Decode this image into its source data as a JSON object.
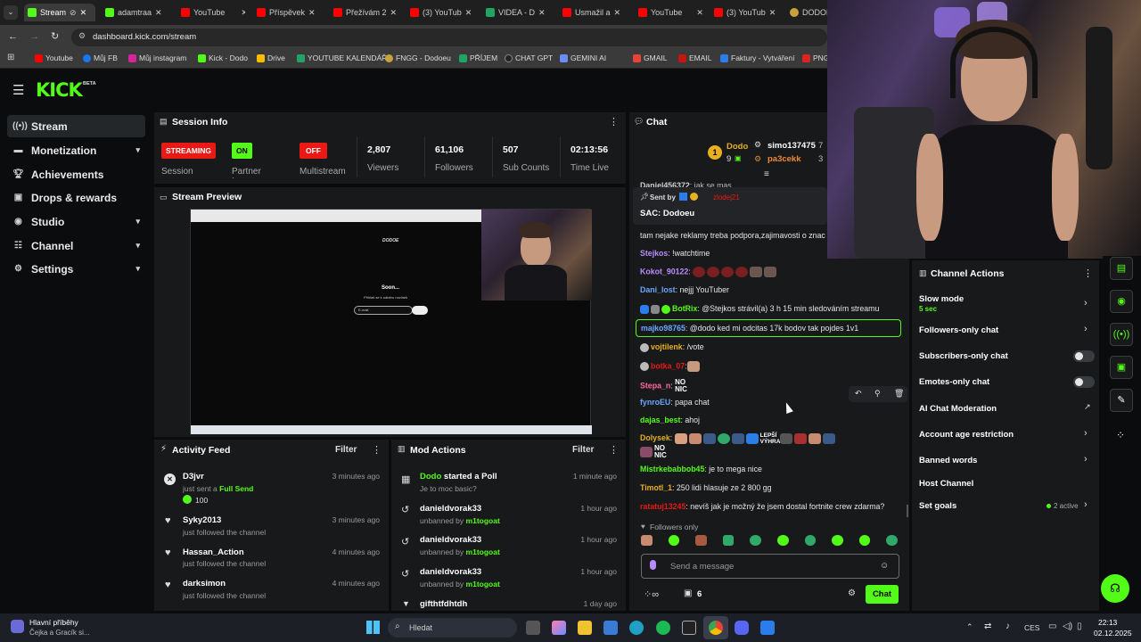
{
  "browser": {
    "tabs": [
      {
        "label": "Stream"
      },
      {
        "label": "adamtraa"
      },
      {
        "label": "YouTube"
      },
      {
        "label": "Příspěvek"
      },
      {
        "label": "Přežívám 2"
      },
      {
        "label": "(3) YouTub"
      },
      {
        "label": "VIDEA - D"
      },
      {
        "label": "Usmažil a"
      },
      {
        "label": "YouTube"
      },
      {
        "label": "(3) YouTub"
      },
      {
        "label": "DODOE"
      }
    ],
    "url": "dashboard.kick.com/stream",
    "bookmarks": [
      "Youtube",
      "Můj FB",
      "Můj instagram",
      "Kick - Dodo",
      "Drive",
      "YOUTUBE KALENDÁŘ",
      "FNGG - Dodoeu",
      "PŘÍJEM",
      "CHAT GPT",
      "GEMINI AI",
      "GMAIL",
      "EMAIL",
      "Faktury - Vytváření",
      "PNG"
    ]
  },
  "kick": {
    "logo": "KICK",
    "logo_sup": "BETA"
  },
  "sidebar": {
    "items": [
      {
        "label": "Stream"
      },
      {
        "label": "Monetization"
      },
      {
        "label": "Achievements"
      },
      {
        "label": "Drops & rewards"
      },
      {
        "label": "Studio"
      },
      {
        "label": "Channel"
      },
      {
        "label": "Settings"
      }
    ]
  },
  "session": {
    "title": "Session Info",
    "streaming_badge": "STREAMING",
    "on_badge": "ON",
    "off_badge": "OFF",
    "session_label": "Session",
    "partner_label": "Partner Income",
    "multistream_label": "Multistream",
    "viewers": "2,807",
    "viewers_label": "Viewers",
    "followers": "61,106",
    "followers_label": "Followers",
    "subs": "507",
    "subs_label": "Sub Counts",
    "time": "02:13:56",
    "time_label": "Time Live"
  },
  "preview": {
    "title": "Stream Preview",
    "site_heading": "Soon...",
    "site_sub": "Přihlaš se k odběru novinek",
    "site_input": "E-mail"
  },
  "activity": {
    "title": "Activity Feed",
    "filter": "Filter",
    "items": [
      {
        "name": "D3jvr",
        "sub": "just sent a",
        "extra": "Full Send",
        "amount": "100",
        "time": "3 minutes ago"
      },
      {
        "name": "Syky2013",
        "sub": "just followed the channel",
        "time": "3 minutes ago"
      },
      {
        "name": "Hassan_Action",
        "sub": "just followed the channel",
        "time": "4 minutes ago"
      },
      {
        "name": "darksimon",
        "sub": "just followed the channel",
        "time": "4 minutes ago"
      }
    ]
  },
  "mod": {
    "title": "Mod Actions",
    "filter": "Filter",
    "items": [
      {
        "name": "Dodo",
        "action": "started a Poll",
        "sub": "Je to moc basic?",
        "time": "1 minute ago"
      },
      {
        "name": "danieldvorak33",
        "sub": "unbanned by",
        "by": "m1togoat",
        "time": "1 hour ago"
      },
      {
        "name": "danieldvorak33",
        "sub": "unbanned by",
        "by": "m1togoat",
        "time": "1 hour ago"
      },
      {
        "name": "danieldvorak33",
        "sub": "unbanned by",
        "by": "m1togoat",
        "time": "1 hour ago"
      },
      {
        "name": "gifthtfdhtdh",
        "time": "1 day ago"
      }
    ]
  },
  "chat": {
    "title": "Chat",
    "leader_name": "Dodo",
    "leader_count": "9",
    "leader_rank": "1",
    "top2": "simo137475",
    "top2_n": "7",
    "top3": "pa3cekk",
    "top3_n": "3",
    "pinned_by": "Sent by",
    "pinned_user": "zlodej21",
    "pinned_text": "SAC: Dodoeu",
    "partial_user": "Daniel456372",
    "partial_text": ": jak se mas",
    "lines": [
      {
        "user": "",
        "text": "tam nejake reklamy treba podpora,zajimavosti o znac"
      },
      {
        "user": "Stejkos",
        "text": ": !watchtime"
      },
      {
        "user": "Kokot_90122",
        "text": ":"
      },
      {
        "user": "Dani_lost",
        "text": ": nejjj YouTuber"
      },
      {
        "user": "BotRix",
        "text": ": @Stejkos strávil(a) 3 h 15 min sledováním streamu"
      },
      {
        "user": "majko98765",
        "text": ": @dodo ked mi odcitas 17k bodov tak pojdes 1v1"
      },
      {
        "user": "vojtilenk",
        "text": ": /vote"
      },
      {
        "user": "botka_07",
        "text": ":"
      },
      {
        "user": "Stepa_n",
        "text": ":"
      },
      {
        "user": "fynroEU",
        "text": ": papa chat"
      },
      {
        "user": "dajas_best",
        "text": ": ahoj"
      },
      {
        "user": "Dolysek",
        "text": ":"
      },
      {
        "user": "Mistrkebabbob45",
        "text": ": je to mega nice"
      },
      {
        "user": "Timotl_1",
        "text": ": 250 lidi hlasuje ze 2 800 gg"
      },
      {
        "user": "ratatuj13245",
        "text": ": nevíš jak je možný že jsem dostal fortnite crew zdarma?"
      }
    ],
    "noic": "NO NIC",
    "lepsi": "LEPŠÍ VÝHRA",
    "followers_only": "Followers only",
    "placeholder": "Send a message",
    "points": "6",
    "send": "Chat"
  },
  "channel_actions": {
    "title": "Channel Actions",
    "slow_mode": "Slow mode",
    "slow_sub": "5 sec",
    "followers_only": "Followers-only chat",
    "subscribers_only": "Subscribers-only chat",
    "emotes_only": "Emotes-only chat",
    "ai_mod": "AI Chat Moderation",
    "account_age": "Account age restriction",
    "banned_words": "Banned words",
    "host": "Host Channel",
    "set_goals": "Set goals",
    "goals_active": "2 active"
  },
  "taskbar": {
    "news_title": "Hlavní příběhy",
    "news_sub": "Čejka a Gracík si...",
    "search": "Hledat",
    "lang": "CES",
    "time": "22:13",
    "date": "02.12.2025"
  },
  "colors": {
    "accent": "#53fc18",
    "streaming": "#e91916",
    "panel": "#18191b",
    "bg": "#0b0c0d"
  }
}
